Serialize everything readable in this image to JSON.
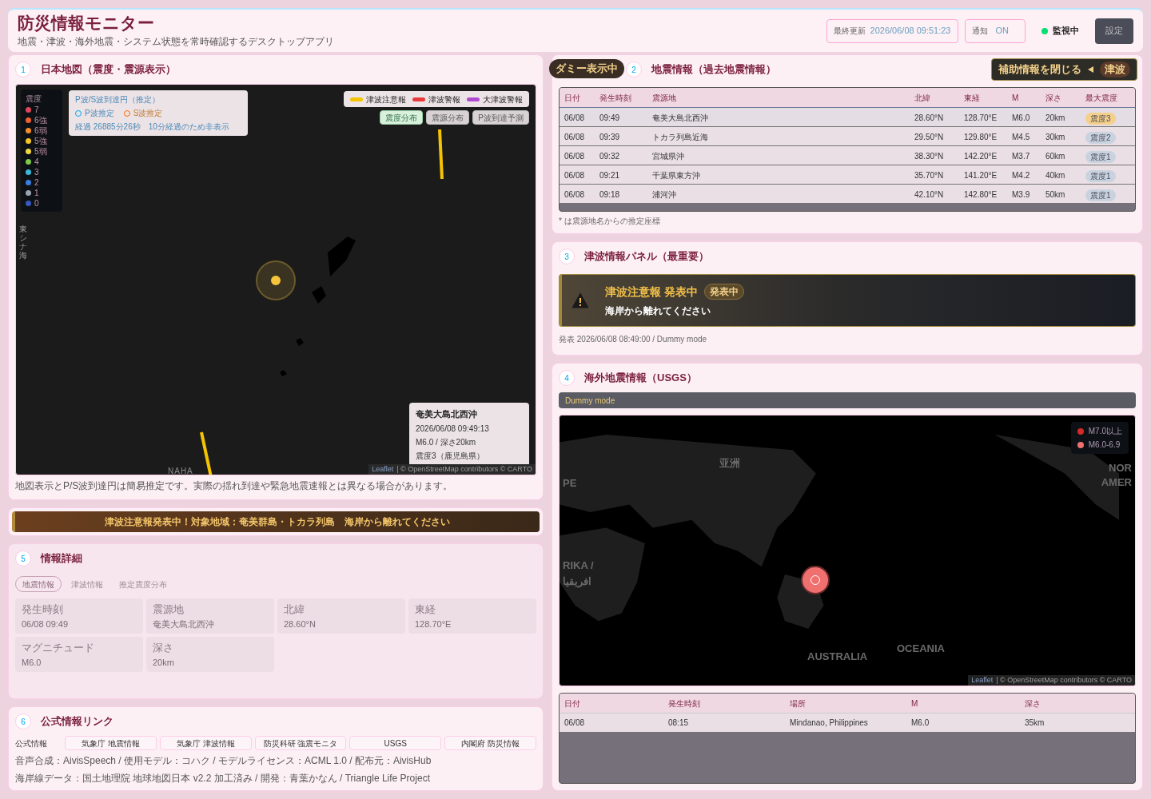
{
  "header": {
    "title": "防災情報モニター",
    "subtitle": "地震・津波・海外地震・システム状態を常時確認するデスクトップアプリ",
    "last_update_label": "最終更新",
    "last_update": "2026/06/08 09:51:23",
    "notify_label": "通知",
    "notify_value": "ON",
    "monitor_status": "監視中",
    "monitoring": true,
    "settings_button": "設定"
  },
  "japan_map": {
    "number": "1",
    "title": "日本地図（震度・震源表示）",
    "intensity_legend": {
      "title": "震度",
      "items": [
        {
          "label": "7",
          "color": "#e0455a"
        },
        {
          "label": "6強",
          "color": "#f06030"
        },
        {
          "label": "6弱",
          "color": "#f68c2a"
        },
        {
          "label": "5強",
          "color": "#f5c526"
        },
        {
          "label": "5弱",
          "color": "#f0d640"
        },
        {
          "label": "4",
          "color": "#7ec84a"
        },
        {
          "label": "3",
          "color": "#3bb7d8"
        },
        {
          "label": "2",
          "color": "#3a7fe0"
        },
        {
          "label": "1",
          "color": "#9aa3ad"
        },
        {
          "label": "0",
          "color": "#3a58c0"
        }
      ]
    },
    "wave_box": {
      "title": "P波/S波到達円（推定）",
      "p_label": "P波推定",
      "s_label": "S波推定",
      "elapsed": "経過 26885分26秒　10分経過のため非表示"
    },
    "tsunami_legend": [
      {
        "label": "津波注意報",
        "color": "#f5c400"
      },
      {
        "label": "津波警報",
        "color": "#e83a3a"
      },
      {
        "label": "大津波警報",
        "color": "#b04ad0"
      }
    ],
    "layer_buttons": [
      {
        "label": "震度分布",
        "selected": true
      },
      {
        "label": "震源分布",
        "selected": false
      },
      {
        "label": "P波到達予測",
        "selected": false
      }
    ],
    "sea_label": "東シナ海",
    "city_label": "NAHA",
    "popup": {
      "place": "奄美大島北西沖",
      "time": "2026/06/08 09:49:13",
      "magnitude_depth": "M6.0 / 深さ20km",
      "intensity": "震度3（鹿児島県）"
    },
    "attribution_leaflet": "Leaflet",
    "attribution": "| © OpenStreetMap contributors © CARTO",
    "note": "地図表示とP/S波到達円は簡易推定です。実際の揺れ到達や緊急地震速報とは異なる場合があります。"
  },
  "ticker": "津波注意報発表中！対象地域：奄美群島・トカラ列島　海岸から離れてください",
  "detail": {
    "number": "5",
    "title": "情報詳細",
    "tabs": [
      {
        "label": "地震情報",
        "selected": true
      },
      {
        "label": "津波情報",
        "selected": false
      },
      {
        "label": "推定震度分布",
        "selected": false
      }
    ],
    "fields": [
      {
        "label": "発生時刻",
        "value": "06/08 09:49"
      },
      {
        "label": "震源地",
        "value": "奄美大島北西沖"
      },
      {
        "label": "北緯",
        "value": "28.60°N"
      },
      {
        "label": "東経",
        "value": "128.70°E"
      },
      {
        "label": "マグニチュード",
        "value": "M6.0"
      },
      {
        "label": "深さ",
        "value": "20km"
      }
    ]
  },
  "links": {
    "number": "6",
    "title": "公式情報リンク",
    "label": "公式情報",
    "buttons": [
      "気象庁 地震情報",
      "気象庁 津波情報",
      "防災科研 強震モニタ",
      "USGS",
      "内閣府 防災情報"
    ],
    "credits": [
      "音声合成：AivisSpeech / 使用モデル：コハク / モデルライセンス：ACML 1.0 / 配布元：AivisHub",
      "海岸線データ：国土地理院 地球地図日本 v2.2 加工済み / 開発：青葉かなん / Triangle Life Project"
    ]
  },
  "quake_list": {
    "number": "2",
    "title": "地震情報（過去地震情報）",
    "dummy_badge": "ダミー表示中",
    "toggle_button": "補助情報を閉じる",
    "toggle_tag": "津波",
    "columns": [
      "日付",
      "発生時刻",
      "震源地",
      "北緯",
      "東経",
      "M",
      "深さ",
      "最大震度"
    ],
    "rows": [
      {
        "date": "06/08",
        "time": "09:49",
        "place": "奄美大島北西沖",
        "lat": "28.60°N",
        "lon": "128.70°E",
        "m": "M6.0",
        "depth": "20km",
        "intensity": "震度3",
        "color": "#f5d08a",
        "selected": true
      },
      {
        "date": "06/08",
        "time": "09:39",
        "place": "トカラ列島近海",
        "lat": "29.50°N",
        "lon": "129.80°E",
        "m": "M4.5",
        "depth": "30km",
        "intensity": "震度2",
        "color": "#c9d3df",
        "selected": false
      },
      {
        "date": "06/08",
        "time": "09:32",
        "place": "宮城県沖",
        "lat": "38.30°N",
        "lon": "142.20°E",
        "m": "M3.7",
        "depth": "60km",
        "intensity": "震度1",
        "color": "#c9d3df",
        "selected": false
      },
      {
        "date": "06/08",
        "time": "09:21",
        "place": "千葉県東方沖",
        "lat": "35.70°N",
        "lon": "141.20°E",
        "m": "M4.2",
        "depth": "40km",
        "intensity": "震度1",
        "color": "#c9d3df",
        "selected": false
      },
      {
        "date": "06/08",
        "time": "09:18",
        "place": "浦河沖",
        "lat": "42.10°N",
        "lon": "142.80°E",
        "m": "M3.9",
        "depth": "50km",
        "intensity": "震度1",
        "color": "#c9d3df",
        "selected": false
      }
    ],
    "note": "* は震源地名からの推定座標"
  },
  "tsunami": {
    "number": "3",
    "title": "津波情報パネル（最重要）",
    "headline": "津波注意報 発表中",
    "status": "発表中",
    "message": "海岸から離れてください",
    "issued": "発表 2026/06/08 08:49:00 / Dummy mode"
  },
  "overseas": {
    "number": "4",
    "title": "海外地震情報（USGS）",
    "mode": "Dummy mode",
    "legend": [
      {
        "label": "M7.0以上",
        "color": "#d42a2a"
      },
      {
        "label": "M6.0-6.9",
        "color": "#f07070"
      }
    ],
    "map_labels": [
      "亚洲",
      "PE",
      "RIKA /",
      "افريقيا",
      "NOR",
      "AMER",
      "AUSTRALIA",
      "OCEANIA"
    ],
    "attribution_leaflet": "Leaflet",
    "attribution": "| © OpenStreetMap contributors © CARTO",
    "columns": [
      "日付",
      "発生時刻",
      "場所",
      "M",
      "深さ"
    ],
    "rows": [
      [
        "06/08",
        "08:15",
        "Mindanao, Philippines",
        "M6.0",
        "35km"
      ]
    ]
  }
}
